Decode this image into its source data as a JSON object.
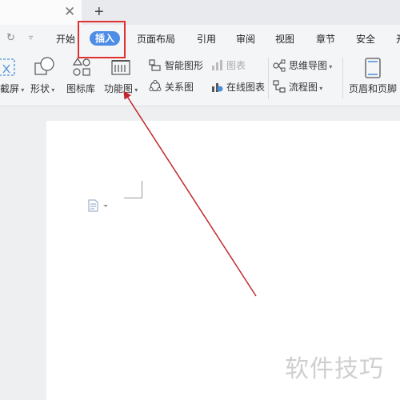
{
  "tabs": {
    "close_icon": "close-icon",
    "new_tab_icon": "plus-icon"
  },
  "menu": {
    "items": [
      {
        "label": "开始"
      },
      {
        "label": "插入",
        "active": true
      },
      {
        "label": "页面布局"
      },
      {
        "label": "引用"
      },
      {
        "label": "审阅"
      },
      {
        "label": "视图"
      },
      {
        "label": "章节"
      },
      {
        "label": "安全"
      },
      {
        "label": "开"
      }
    ]
  },
  "toolbar": {
    "screenshot_label": "截屏",
    "shapes_label": "形状",
    "icon_library_label": "图标库",
    "function_chart_label": "功能图",
    "smart_graphic_label": "智能图形",
    "chart_label": "图表",
    "relation_chart_label": "关系图",
    "online_chart_label": "在线图表",
    "mind_map_label": "思维导图",
    "flowchart_label": "流程图",
    "header_footer_label": "页眉和页脚"
  },
  "watermark": {
    "text": "软件技巧"
  },
  "colors": {
    "accent": "#4e8de6",
    "highlight": "#e03030",
    "arrow": "#c0282d"
  }
}
